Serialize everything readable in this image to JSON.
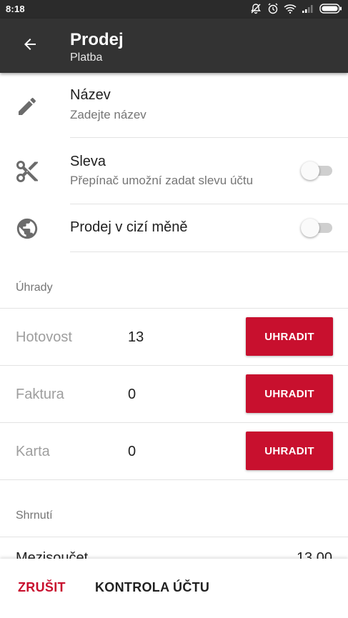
{
  "status_bar": {
    "time": "8:18",
    "icons": [
      "mute-icon",
      "alarm-icon",
      "wifi-icon",
      "signal-icon",
      "battery-icon"
    ]
  },
  "app_bar": {
    "title": "Prodej",
    "subtitle": "Platba",
    "back_icon": "arrow-back-icon"
  },
  "settings": {
    "name": {
      "title": "Název",
      "hint": "Zadejte název",
      "icon": "pencil-icon"
    },
    "discount": {
      "title": "Sleva",
      "description": "Přepínač umožní zadat slevu účtu",
      "icon": "scissors-icon",
      "enabled": false
    },
    "foreign_currency": {
      "title": "Prodej v cizí měně",
      "icon": "globe-icon",
      "enabled": false
    }
  },
  "payments": {
    "section_label": "Úhrady",
    "rows": [
      {
        "name": "Hotovost",
        "amount": "13",
        "button": "UHRADIT"
      },
      {
        "name": "Faktura",
        "amount": "0",
        "button": "UHRADIT"
      },
      {
        "name": "Karta",
        "amount": "0",
        "button": "UHRADIT"
      }
    ]
  },
  "summary": {
    "section_label": "Shrnutí",
    "subtotal_label": "Mezisoučet",
    "subtotal_value": "13,00"
  },
  "bottom_actions": {
    "cancel": "ZRUŠIT",
    "check": "KONTROLA ÚČTU"
  },
  "colors": {
    "accent": "#c8102e",
    "app_bar": "#333333",
    "status_bar": "#2b2b2b"
  }
}
